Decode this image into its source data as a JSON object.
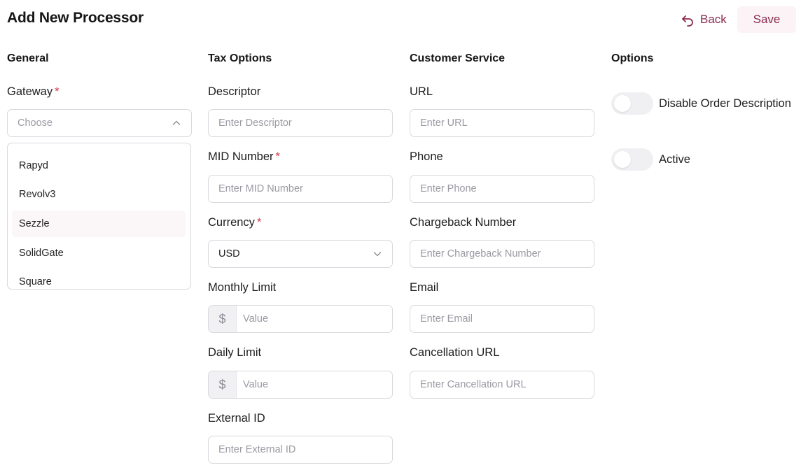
{
  "header": {
    "title": "Add New Processor",
    "back_label": "Back",
    "save_label": "Save"
  },
  "general": {
    "title": "General",
    "gateway_label": "Gateway",
    "required_mark": "*",
    "gateway_placeholder": "Choose",
    "gateway_options": [
      "Rapyd",
      "Revolv3",
      "Sezzle",
      "SolidGate",
      "Square"
    ]
  },
  "tax": {
    "title": "Tax Options",
    "descriptor_label": "Descriptor",
    "descriptor_placeholder": "Enter Descriptor",
    "mid_label": "MID Number",
    "mid_placeholder": "Enter MID Number",
    "currency_label": "Currency",
    "currency_value": "USD",
    "monthly_label": "Monthly Limit",
    "monthly_prefix": "$",
    "monthly_placeholder": "Value",
    "daily_label": "Daily Limit",
    "daily_prefix": "$",
    "daily_placeholder": "Value",
    "external_label": "External ID",
    "external_placeholder": "Enter External ID"
  },
  "customer_service": {
    "title": "Customer Service",
    "url_label": "URL",
    "url_placeholder": "Enter URL",
    "phone_label": "Phone",
    "phone_placeholder": "Enter Phone",
    "chargeback_label": "Chargeback Number",
    "chargeback_placeholder": "Enter Chargeback Number",
    "email_label": "Email",
    "email_placeholder": "Enter Email",
    "cancellation_label": "Cancellation URL",
    "cancellation_placeholder": "Enter Cancellation URL"
  },
  "options": {
    "title": "Options",
    "disable_desc_label": "Disable Order Description",
    "disable_desc_on": false,
    "active_label": "Active",
    "active_on": false
  },
  "colors": {
    "accent": "#8a2b4f",
    "required": "#d33a4a"
  }
}
